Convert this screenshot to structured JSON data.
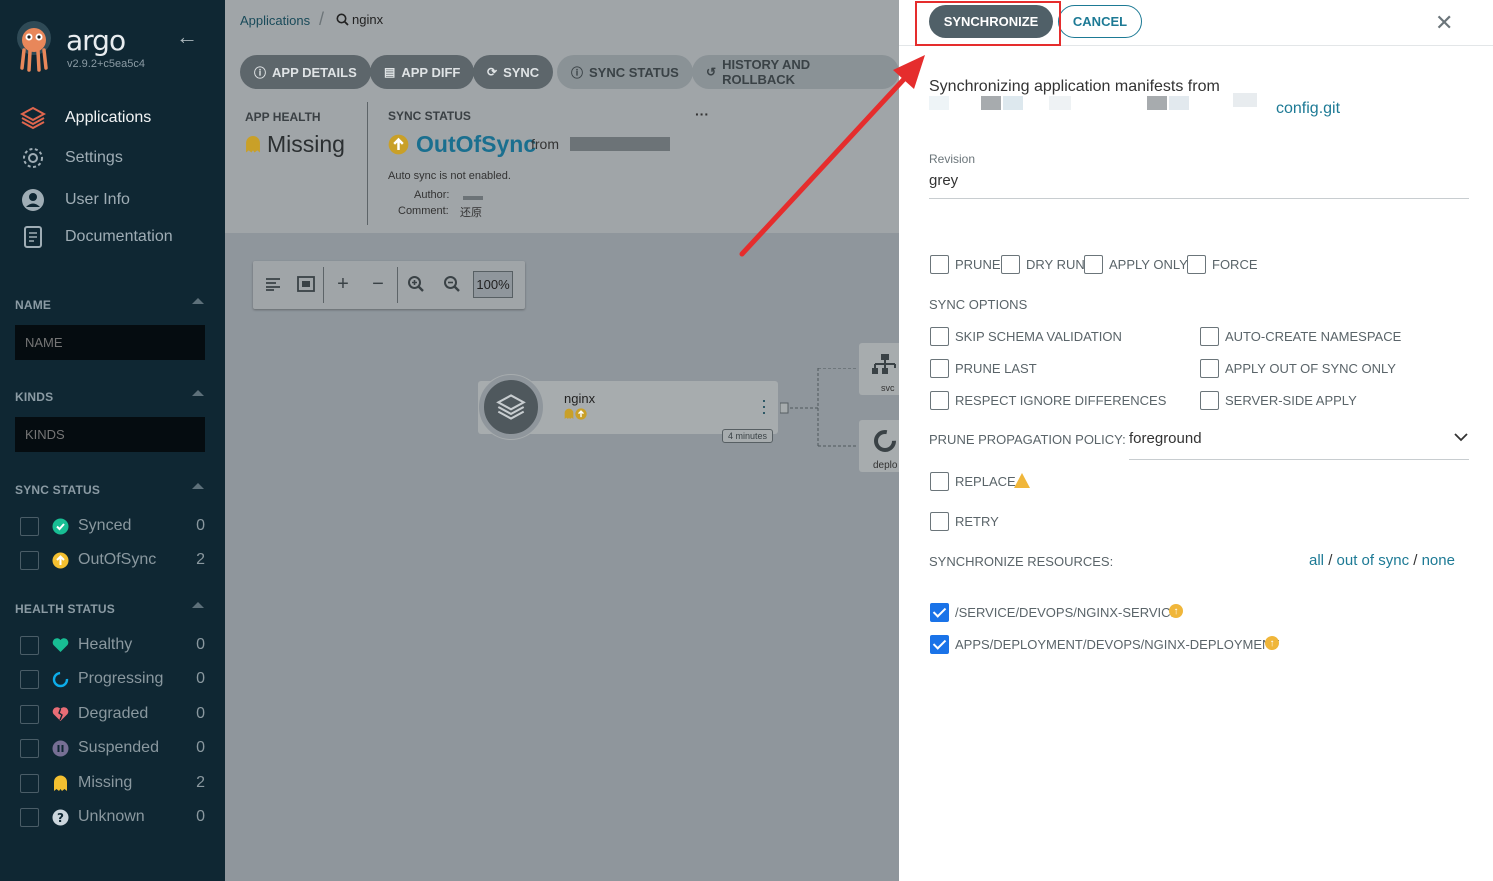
{
  "sidebar": {
    "brand": "argo",
    "version": "v2.9.2+c5ea5c4",
    "nav": [
      {
        "label": "Applications",
        "icon": "stack-icon"
      },
      {
        "label": "Settings",
        "icon": "gear-icon"
      },
      {
        "label": "User Info",
        "icon": "user-icon"
      },
      {
        "label": "Documentation",
        "icon": "book-icon"
      }
    ],
    "name_section": "NAME",
    "name_placeholder": "NAME",
    "kinds_section": "KINDS",
    "kinds_placeholder": "KINDS",
    "sync_section": "SYNC STATUS",
    "sync_filters": [
      {
        "label": "Synced",
        "count": "0",
        "color": "#18be94"
      },
      {
        "label": "OutOfSync",
        "count": "2",
        "color": "#f4c030"
      }
    ],
    "health_section": "HEALTH STATUS",
    "health_filters": [
      {
        "label": "Healthy",
        "count": "0",
        "color": "#18be94"
      },
      {
        "label": "Progressing",
        "count": "0",
        "color": "#0dadea"
      },
      {
        "label": "Degraded",
        "count": "0",
        "color": "#e96d76"
      },
      {
        "label": "Suspended",
        "count": "0",
        "color": "#766f94"
      },
      {
        "label": "Missing",
        "count": "2",
        "color": "#f4c030"
      },
      {
        "label": "Unknown",
        "count": "0",
        "color": "#ccd6dd"
      }
    ]
  },
  "main": {
    "breadcrumb_app": "Applications",
    "breadcrumb_current": "nginx",
    "toolbar": [
      "APP DETAILS",
      "APP DIFF",
      "SYNC",
      "SYNC STATUS",
      "HISTORY AND ROLLBACK"
    ],
    "app_health_label": "APP HEALTH",
    "app_health_value": "Missing",
    "sync_status_label": "SYNC STATUS",
    "sync_status_value": "OutOfSync",
    "from_label": "from",
    "auto_sync_text": "Auto sync is not enabled.",
    "author_label": "Author:",
    "comment_label": "Comment:",
    "comment_value": "还原",
    "more": "···",
    "zoom": "100%",
    "node_name": "nginx",
    "node_age": "4 minutes",
    "svc_label": "svc",
    "deploy_label": "deplo"
  },
  "panel": {
    "synchronize": "SYNCHRONIZE",
    "cancel": "CANCEL",
    "close": "✕",
    "intro": "Synchronizing application manifests from",
    "repo_link": "config.git",
    "revision_label": "Revision",
    "revision_value": "grey",
    "top_options": [
      "PRUNE",
      "DRY RUN",
      "APPLY ONLY",
      "FORCE"
    ],
    "sync_options_head": "SYNC OPTIONS",
    "sync_options_left": [
      "SKIP SCHEMA VALIDATION",
      "PRUNE LAST",
      "RESPECT IGNORE DIFFERENCES"
    ],
    "sync_options_right": [
      "AUTO-CREATE NAMESPACE",
      "APPLY OUT OF SYNC ONLY",
      "SERVER-SIDE APPLY"
    ],
    "prune_policy_label": "PRUNE PROPAGATION POLICY:",
    "prune_policy_value": "foreground",
    "replace": "REPLACE",
    "retry": "RETRY",
    "resources_head": "SYNCHRONIZE RESOURCES:",
    "res_all": "all",
    "res_out": "out of sync",
    "res_none": "none",
    "res_sep": "/",
    "resources": [
      "/SERVICE/DEVOPS/NGINX-SERVICE",
      "APPS/DEPLOYMENT/DEVOPS/NGINX-DEPLOYMENT"
    ]
  }
}
